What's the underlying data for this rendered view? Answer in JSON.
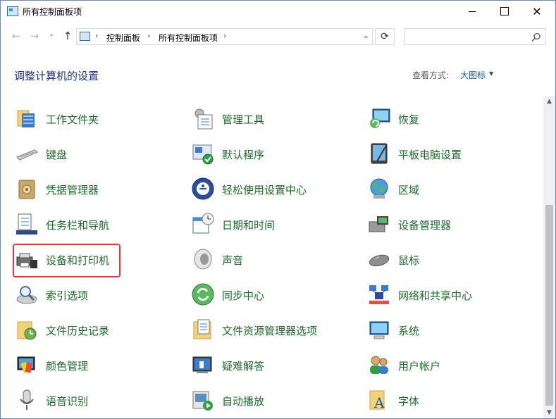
{
  "window": {
    "title": "所有控制面板项",
    "minimize_label": "",
    "maximize_label": "",
    "close_label": "✕"
  },
  "address": {
    "breadcrumbs": [
      "控制面板",
      "所有控制面板项"
    ],
    "search_placeholder": ""
  },
  "header": {
    "title": "调整计算机的设置",
    "view_by_label": "查看方式:",
    "view_by_value": "大图标"
  },
  "items": [
    [
      {
        "label": "工作文件夹",
        "icon": "work-folders-icon"
      },
      {
        "label": "键盘",
        "icon": "keyboard-icon"
      },
      {
        "label": "凭据管理器",
        "icon": "credential-manager-icon"
      },
      {
        "label": "任务栏和导航",
        "icon": "taskbar-icon"
      },
      {
        "label": "设备和打印机",
        "icon": "devices-printers-icon"
      },
      {
        "label": "索引选项",
        "icon": "indexing-options-icon"
      },
      {
        "label": "文件历史记录",
        "icon": "file-history-icon"
      },
      {
        "label": "颜色管理",
        "icon": "color-management-icon"
      },
      {
        "label": "语音识别",
        "icon": "speech-recognition-icon"
      }
    ],
    [
      {
        "label": "管理工具",
        "icon": "admin-tools-icon"
      },
      {
        "label": "默认程序",
        "icon": "default-programs-icon"
      },
      {
        "label": "轻松使用设置中心",
        "icon": "ease-of-access-icon"
      },
      {
        "label": "日期和时间",
        "icon": "date-time-icon"
      },
      {
        "label": "声音",
        "icon": "sound-icon"
      },
      {
        "label": "同步中心",
        "icon": "sync-center-icon"
      },
      {
        "label": "文件资源管理器选项",
        "icon": "explorer-options-icon"
      },
      {
        "label": "疑难解答",
        "icon": "troubleshooting-icon"
      },
      {
        "label": "自动播放",
        "icon": "autoplay-icon"
      }
    ],
    [
      {
        "label": "恢复",
        "icon": "recovery-icon"
      },
      {
        "label": "平板电脑设置",
        "icon": "tablet-settings-icon"
      },
      {
        "label": "区域",
        "icon": "region-icon"
      },
      {
        "label": "设备管理器",
        "icon": "device-manager-icon"
      },
      {
        "label": "鼠标",
        "icon": "mouse-icon"
      },
      {
        "label": "网络和共享中心",
        "icon": "network-sharing-icon"
      },
      {
        "label": "系统",
        "icon": "system-icon"
      },
      {
        "label": "用户帐户",
        "icon": "user-accounts-icon"
      },
      {
        "label": "字体",
        "icon": "fonts-icon"
      }
    ]
  ],
  "highlighted_item": "设备和打印机",
  "colors": {
    "item_text": "#1a6a2a",
    "title_text": "#1e3287",
    "link_text": "#1a5aa6",
    "highlight": "#e53939"
  }
}
